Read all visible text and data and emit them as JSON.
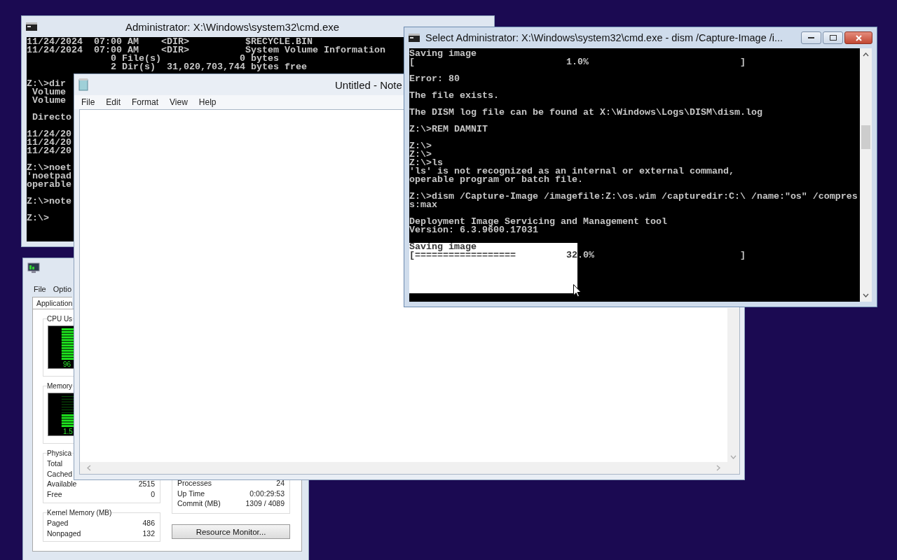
{
  "desktop": {
    "cmd_window_back": {
      "title": "Administrator: X:\\Windows\\system32\\cmd.exe",
      "console_blocks": [
        {
          "lines": [
            "11/24/2024  07:00 AM    <DIR>          $RECYCLE.BIN",
            "11/24/2024  07:00 AM    <DIR>          System Volume Information",
            "               0 File(s)              0 bytes",
            "               2 Dir(s)  31,020,703,744 bytes free"
          ]
        },
        {
          "lines": [
            "Z:\\>dir",
            " Volume",
            " Volume"
          ]
        },
        {
          "lines": [
            " Directo"
          ]
        },
        {
          "lines": [
            "11/24/20",
            "11/24/20",
            "11/24/20"
          ]
        },
        {
          "lines": [
            "Z:\\>noet",
            "'noetpad",
            "operable"
          ]
        },
        {
          "lines": [
            "Z:\\>note"
          ]
        },
        {
          "lines": [
            "Z:\\>"
          ]
        }
      ]
    },
    "task_manager": {
      "menu": [
        "File",
        "Optio"
      ],
      "tabs": [
        {
          "label": "Application",
          "selected": true
        }
      ],
      "cpu": {
        "title": "CPU Us",
        "level": 0.96,
        "reading": "96"
      },
      "memory": {
        "title": "Memory",
        "level": 0.38,
        "reading": "1.5"
      },
      "physical": {
        "title": "Physica",
        "rows": [
          {
            "label": "Total"
          },
          {
            "label": "Cached"
          },
          {
            "label": "Available",
            "value": "2515"
          },
          {
            "label": "Free",
            "value": "0"
          }
        ]
      },
      "kernel": {
        "title": "Kernel Memory (MB)",
        "rows": [
          {
            "label": "Paged",
            "value": "486"
          },
          {
            "label": "Nonpaged",
            "value": "132"
          }
        ]
      },
      "system": {
        "rows": [
          {
            "label": "Processes",
            "value": "24"
          },
          {
            "label": "Up Time",
            "value": "0:00:29:53"
          },
          {
            "label": "Commit (MB)",
            "value": "1309 / 4089"
          }
        ]
      },
      "button": "Resource Monitor..."
    },
    "notepad": {
      "title": "Untitled - Note",
      "menu": [
        "File",
        "Edit",
        "Format",
        "View",
        "Help"
      ]
    },
    "cmd_window_front": {
      "title": "Select Administrator: X:\\Windows\\system32\\cmd.exe - dism  /Capture-Image /i...",
      "console_blocks": [
        {
          "lines": [
            "Saving image",
            "[                           1.0%                           ]"
          ]
        },
        {
          "lines": [
            "Error: 80"
          ]
        },
        {
          "lines": [
            "The file exists."
          ]
        },
        {
          "lines": [
            "The DISM log file can be found at X:\\Windows\\Logs\\DISM\\dism.log"
          ]
        },
        {
          "lines": [
            "Z:\\>REM DAMNIT"
          ]
        },
        {
          "lines": [
            "Z:\\>",
            "Z:\\>",
            "Z:\\>ls",
            "'ls' is not recognized as an internal or external command,",
            "operable program or batch file."
          ]
        },
        {
          "lines": [
            "Z:\\>dism /Capture-Image /imagefile:Z:\\os.wim /capturedir:C:\\ /name:\"os\" /compres",
            "s:max"
          ]
        },
        {
          "lines": [
            "Deployment Image Servicing and Management tool",
            "Version: 6.3.9600.17031"
          ]
        },
        {
          "lines": [
            "Saving image",
            "[==================         32.0%                          ]"
          ]
        }
      ],
      "has_selection": true
    }
  }
}
